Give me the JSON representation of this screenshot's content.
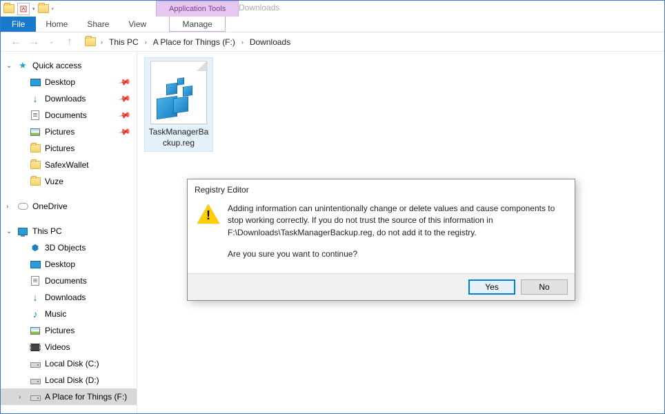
{
  "window": {
    "app_tools_label": "Application Tools",
    "title": "Downloads"
  },
  "ribbon": {
    "file": "File",
    "tabs": [
      "Home",
      "Share",
      "View"
    ],
    "context_tab": "Manage"
  },
  "address": {
    "segments": [
      "This PC",
      "A Place for Things (F:)",
      "Downloads"
    ]
  },
  "sidebar": {
    "quick_access": "Quick access",
    "quick_items": [
      {
        "label": "Desktop",
        "icon": "desktop",
        "pinned": true
      },
      {
        "label": "Downloads",
        "icon": "download",
        "pinned": true
      },
      {
        "label": "Documents",
        "icon": "doc",
        "pinned": true
      },
      {
        "label": "Pictures",
        "icon": "pic",
        "pinned": true
      },
      {
        "label": "Pictures",
        "icon": "folder",
        "pinned": false
      },
      {
        "label": "SafexWallet",
        "icon": "folder",
        "pinned": false
      },
      {
        "label": "Vuze",
        "icon": "folder",
        "pinned": false
      }
    ],
    "onedrive": "OneDrive",
    "thispc": "This PC",
    "pc_items": [
      {
        "label": "3D Objects",
        "icon": "3d"
      },
      {
        "label": "Desktop",
        "icon": "desktop"
      },
      {
        "label": "Documents",
        "icon": "doc"
      },
      {
        "label": "Downloads",
        "icon": "download"
      },
      {
        "label": "Music",
        "icon": "music"
      },
      {
        "label": "Pictures",
        "icon": "pic"
      },
      {
        "label": "Videos",
        "icon": "video"
      },
      {
        "label": "Local Disk (C:)",
        "icon": "drive"
      },
      {
        "label": "Local Disk (D:)",
        "icon": "drive"
      },
      {
        "label": "A Place for Things (F:)",
        "icon": "drive",
        "selected": true
      }
    ]
  },
  "files": [
    {
      "name": "TaskManagerBackup.reg"
    }
  ],
  "dialog": {
    "title": "Registry Editor",
    "line1": "Adding information can unintentionally change or delete values and cause components to stop working correctly. If you do not trust the source of this information in F:\\Downloads\\TaskManagerBackup.reg, do not add it to the registry.",
    "line2": "Are you sure you want to continue?",
    "yes": "Yes",
    "no": "No"
  }
}
